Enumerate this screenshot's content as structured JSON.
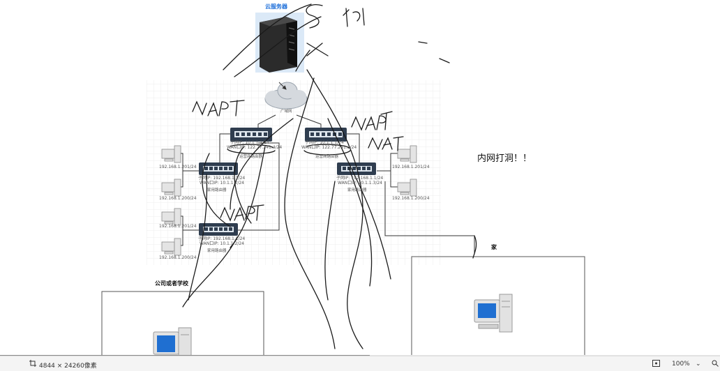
{
  "diagram": {
    "title_cloud_server": "云服务器",
    "internet_label": "广域网",
    "left_isp_router": {
      "lan_ip": "子网IP:   10.1.1.1/24",
      "wan_ip": "WAN口IP:  122.77.241.4/24",
      "name": "运营商路由器"
    },
    "right_isp_router": {
      "lan_ip": "子网IP:   10.1.1.1/24",
      "wan_ip": "WAN口IP:  122.77.241.3/24",
      "name": "运营商路由器"
    },
    "home_router_a": {
      "lan_ip": "子网IP:   192.168.1.1/24",
      "wan_ip": "WAN口IP:  10.1.1.2/24",
      "name": "家用路由器"
    },
    "home_router_b": {
      "lan_ip": "子网IP:   192.168.1.1/24",
      "wan_ip": "WAN口IP:  10.1.1.3/24",
      "name": "家用路由器"
    },
    "home_router_c": {
      "lan_ip": "子网IP:   192.168.1.1/24",
      "wan_ip": "WAN口IP:  10.1.1.2/24",
      "name": "家用路由器"
    },
    "pcs": {
      "pc_a1": "192.168.1.201/24",
      "pc_a2": "192.168.1.200/24",
      "pc_c1": "192.168.1.201/24",
      "pc_c2": "192.168.1.200/24",
      "pc_b1": "192.168.1.201/24",
      "pc_b2": "192.168.1.200/24"
    },
    "hole_punch_note": "内网打洞！！",
    "home_box_label": "家",
    "company_box_label": "公司或者学校"
  },
  "status_bar": {
    "dimensions": "4844 × 24260像素",
    "zoom": "100%"
  }
}
